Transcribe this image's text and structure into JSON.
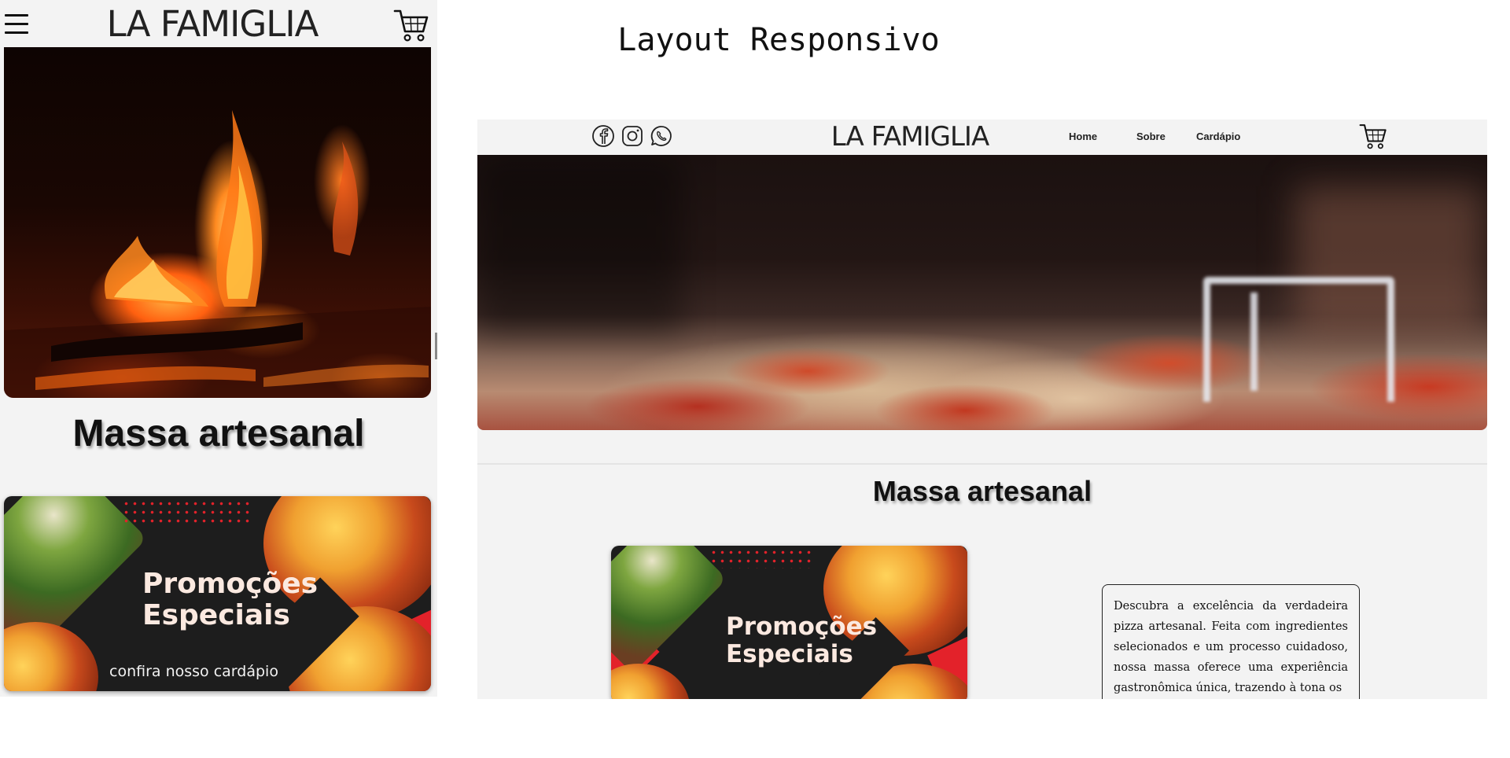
{
  "page_title": "Layout Responsivo",
  "brand": "LA FAMIGLIA",
  "colors": {
    "page_background": "#ffffff",
    "mockup_background": "#f3f3f3",
    "promo_background": "#1d1d1d",
    "promo_accent": "#e3222a",
    "text": "#111111"
  },
  "mobile": {
    "menu_icon": "hamburger-menu-icon",
    "cart_icon": "shopping-cart-icon",
    "hero_image": "fireplace-flames",
    "section_title": "Massa artesanal",
    "promo": {
      "title_line1": "Promoções",
      "title_line2": "Especiais",
      "subtitle": "confira nosso cardápio"
    }
  },
  "desktop": {
    "social_icons": [
      "facebook-icon",
      "instagram-icon",
      "whatsapp-icon"
    ],
    "nav": {
      "home": "Home",
      "sobre": "Sobre",
      "cardapio": "Cardápio"
    },
    "cart_icon": "shopping-cart-icon",
    "hero_image": "pepperoni-pizza-blurred",
    "section_title": "Massa artesanal",
    "promo": {
      "title_line1": "Promoções",
      "title_line2": "Especiais"
    },
    "description": "Descubra a excelência da verdadeira pizza artesanal. Feita com ingredientes selecionados e um processo cuidadoso, nossa massa oferece uma experiência gastronômica única, trazendo à tona os"
  }
}
